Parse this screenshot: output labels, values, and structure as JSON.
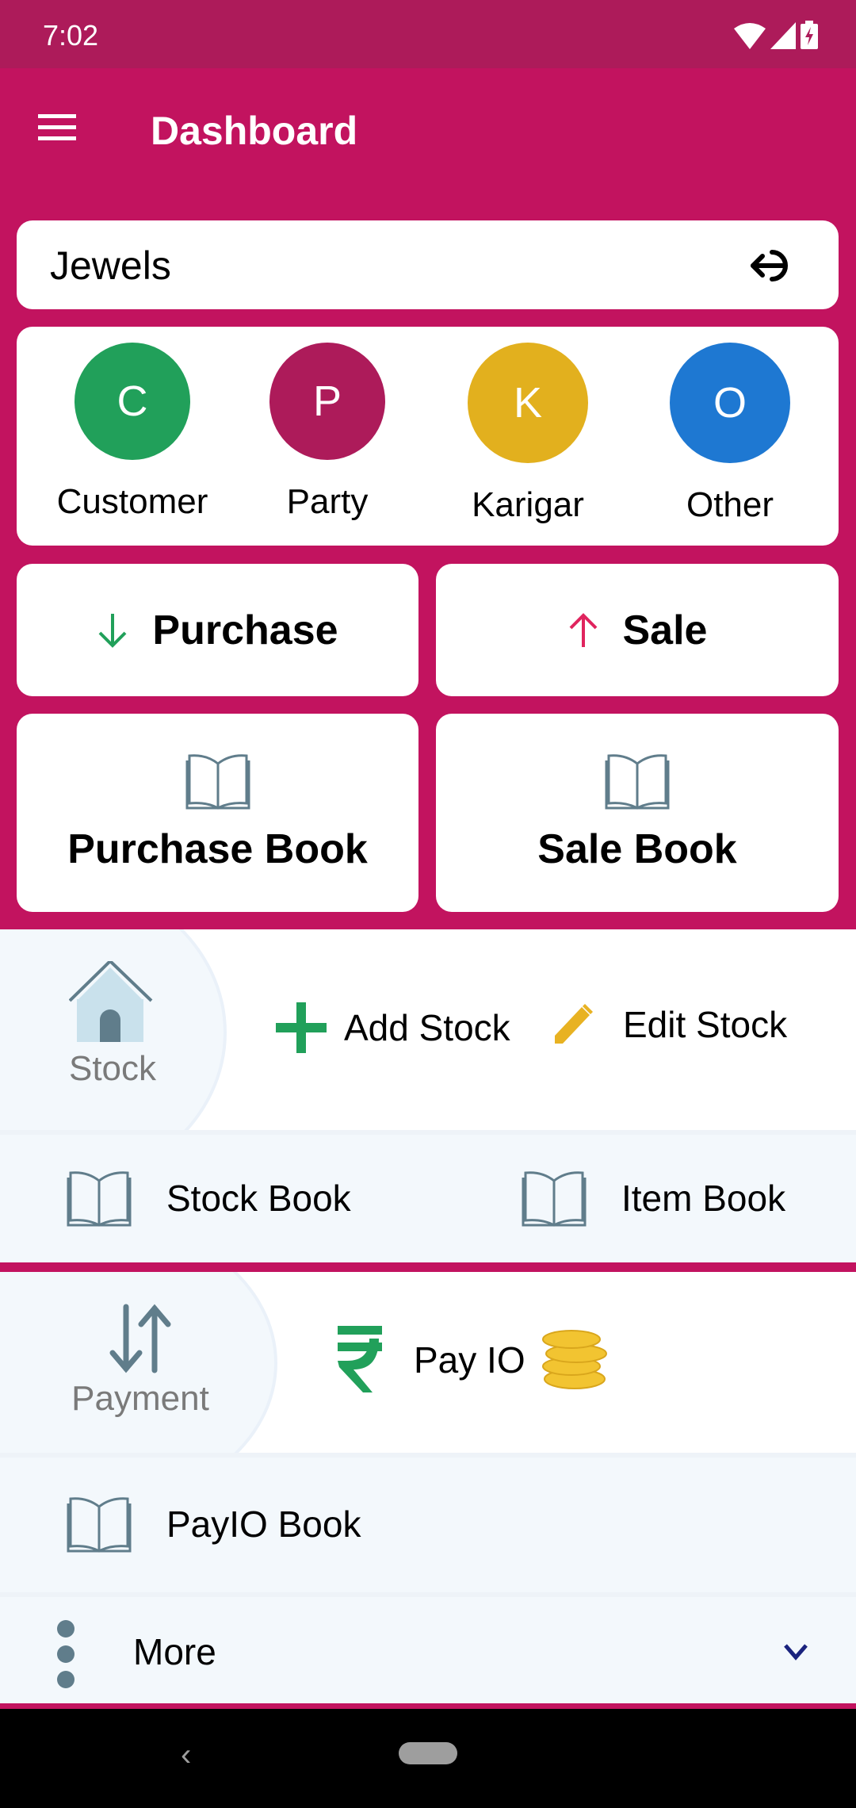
{
  "status_bar": {
    "time": "7:02",
    "icons": [
      "wifi-icon",
      "signal-icon",
      "battery-charging-icon"
    ]
  },
  "app_bar": {
    "title": "Dashboard",
    "menu_icon": "hamburger-menu-icon"
  },
  "colors": {
    "primary": "#C2135F",
    "status_bar": "#AD1B5A",
    "green": "#21A05A",
    "yellow": "#E2B01E",
    "blue": "#1E78D2",
    "party": "#AD1B5A",
    "icon_gray": "#607D8B"
  },
  "firm": {
    "name": "Jewels",
    "logout_icon": "logout-icon"
  },
  "contacts": [
    {
      "letter": "C",
      "label": "Customer",
      "color": "#21A05A"
    },
    {
      "letter": "P",
      "label": "Party",
      "color": "#AD1B5A"
    },
    {
      "letter": "K",
      "label": "Karigar",
      "color": "#E2B01E"
    },
    {
      "letter": "O",
      "label": "Other",
      "color": "#1E78D2"
    }
  ],
  "actions": {
    "purchase": "Purchase",
    "sale": "Sale",
    "purchase_book": "Purchase Book",
    "sale_book": "Sale Book"
  },
  "stock": {
    "title": "Stock",
    "add": "Add Stock",
    "edit": "Edit Stock",
    "stock_book": "Stock Book",
    "item_book": "Item Book"
  },
  "payment": {
    "title": "Payment",
    "pay_io": "Pay IO",
    "payio_book": "PayIO Book"
  },
  "more": {
    "label": "More"
  }
}
